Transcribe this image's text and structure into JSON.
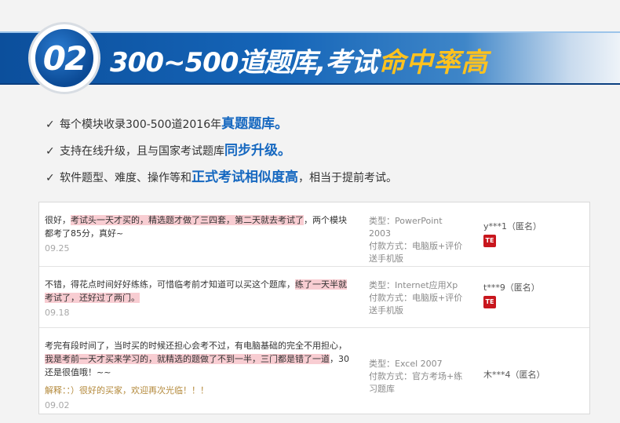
{
  "banner": {
    "badge_number": "02",
    "title_main": "300~500道题库,考试",
    "title_highlight": "命中率高"
  },
  "bullets": [
    {
      "check": "✓",
      "pre": "每个模块收录300-500道2016年",
      "highlight": "真题题库。",
      "post": ""
    },
    {
      "check": "✓",
      "pre": "支持在线升级，且与国家考试题库",
      "highlight": "同步升级。",
      "post": ""
    },
    {
      "check": "✓",
      "pre": "软件题型、难度、操作等和",
      "highlight": "正式考试相似度高",
      "post": "，相当于提前考试。"
    }
  ],
  "reviews": [
    {
      "parts": [
        "很好，",
        "考试头一天才买的，精选题才做了三四套，第二天就去考试了",
        "，两个模块都考了85分，真好~"
      ],
      "date": "09.25",
      "meta": [
        "类型：PowerPoint 2003",
        "付款方式：电脑版+评价送手机版"
      ],
      "user": "y***1（匿名）",
      "badge": "TE"
    },
    {
      "parts": [
        "不错，得花点时间好好练练，可惜临考前才知道可以买这个题库，",
        "练了一天半就考试了，还好过了两门。",
        ""
      ],
      "date": "09.18",
      "meta": [
        "类型：Internet应用Xp",
        "付款方式：电脑版+评价送手机版"
      ],
      "user": "t***9（匿名）",
      "badge": "TE"
    },
    {
      "parts": [
        "考完有段时间了，当时买的时候还担心会考不过，有电脑基础的完全不用担心，",
        "我是考前一天才买来学习的，就精选的题做了不到一半，三门都是错了一道",
        "，30还是很值哦！~~"
      ],
      "reply": "解释：：）很好的买家，欢迎再次光临！！！",
      "date": "09.02",
      "meta": [
        "类型：Excel 2007",
        "付款方式：官方考场+练习题库"
      ],
      "user": "木***4（匿名）"
    }
  ]
}
